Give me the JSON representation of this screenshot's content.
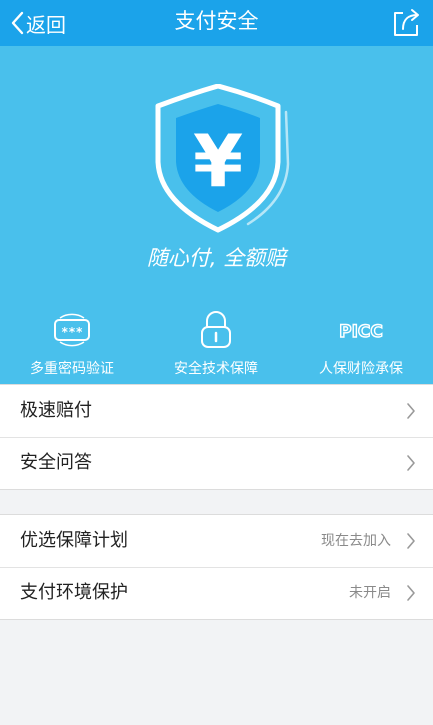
{
  "nav": {
    "back_label": "返回",
    "title": "支付安全"
  },
  "hero": {
    "shield_symbol": "¥",
    "slogan": "随心付, 全额赔",
    "features": [
      {
        "icon": "password-keypad-icon",
        "label": "多重密码验证"
      },
      {
        "icon": "lock-icon",
        "label": "安全技术保障"
      },
      {
        "icon": "picc-logo",
        "label": "人保财险承保",
        "logo_text": "PICC"
      }
    ]
  },
  "group1": [
    {
      "label": "极速赔付"
    },
    {
      "label": "安全问答"
    }
  ],
  "group2": [
    {
      "label": "优选保障计划",
      "value": "现在去加入"
    },
    {
      "label": "支付环境保护",
      "value": "未开启"
    }
  ],
  "colors": {
    "nav_bg": "#1ba3ea",
    "hero_bg": "#49c0ec",
    "page_bg": "#f2f3f5"
  }
}
